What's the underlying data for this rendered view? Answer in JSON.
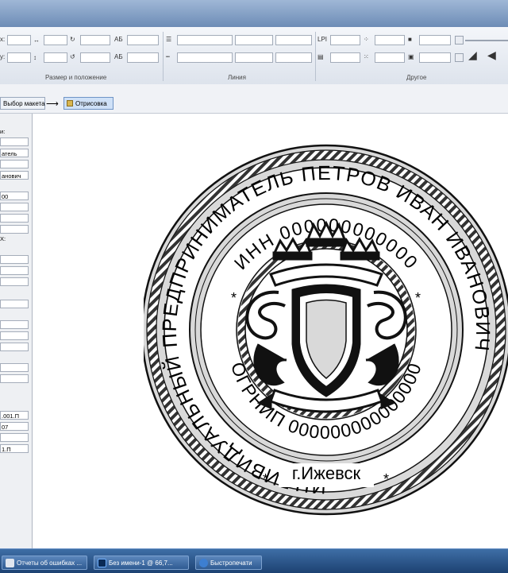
{
  "ribbon": {
    "group_size_position": "Размер и положение",
    "group_line": "Линия",
    "group_other": "Другое",
    "label_lpi": "LPI",
    "field_suffix_x": "x:",
    "field_suffix_y": "y:",
    "ab_label": "АБ"
  },
  "breadcrumb": {
    "layout_label": "Выбор макета",
    "drawing_label": "Отрисовка"
  },
  "left_panel": {
    "label_1": "и:",
    "field_1": "атель",
    "field_2": "анович",
    "field_3": "00",
    "label_2": "X:",
    "field_4": ".001.П",
    "field_5": "07",
    "field_6": "1.П"
  },
  "stamp": {
    "outer_text": "ИНДИВИДУАЛЬНЫЙ ПРЕДПРИНИМАТЕЛЬ ПЕТРОВ ИВАН ИВАНОВИЧ",
    "inn_text": "ИНН 000000000000",
    "ogrnip_text": "ОГРНИП 000000000000000",
    "city_text": "г.Ижевск",
    "star_left": "*",
    "star_right": "*",
    "star_bl": "*",
    "star_br": "*"
  },
  "taskbar": {
    "item_1": "Отчеты об ошибках ...",
    "item_2": "Без имени-1 @ 66,7...",
    "item_3": "Быстропечати"
  }
}
